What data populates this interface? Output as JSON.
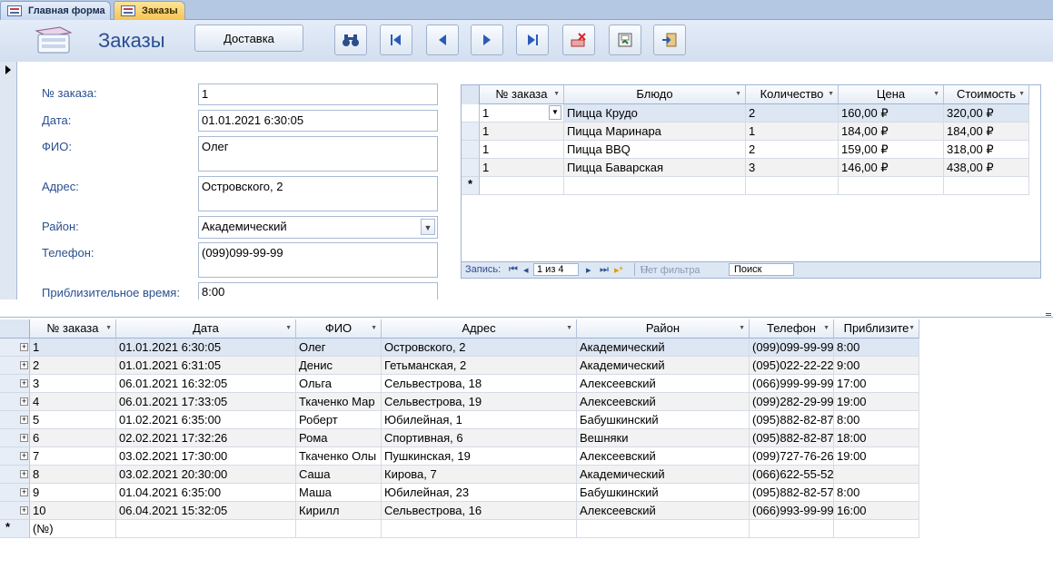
{
  "tabs": [
    {
      "label": "Главная форма",
      "active": false
    },
    {
      "label": "Заказы",
      "active": true
    }
  ],
  "header": {
    "title": "Заказы",
    "delivery_button": "Доставка",
    "nav_icons": [
      "binoculars-icon",
      "first-record-icon",
      "prev-record-icon",
      "next-record-icon",
      "last-record-icon",
      "delete-record-icon",
      "save-icon",
      "exit-icon"
    ]
  },
  "form": {
    "fields": [
      {
        "label": "№ заказа:",
        "value": "1"
      },
      {
        "label": "Дата:",
        "value": "01.01.2021 6:30:05"
      },
      {
        "label": "ФИО:",
        "value": "Олег"
      },
      {
        "label": "Адрес:",
        "value": "Островского, 2"
      },
      {
        "label": "Район:",
        "value": "Академический"
      },
      {
        "label": "Телефон:",
        "value": "(099)099-99-99"
      },
      {
        "label": "Приблизительное время:",
        "value": "8:00"
      }
    ]
  },
  "subform": {
    "columns": [
      "№ заказа",
      "Блюдо",
      "Количество",
      "Цена",
      "Стоимость"
    ],
    "rows": [
      [
        "1",
        "Пицца Крудо",
        "2",
        "160,00 ₽",
        "320,00 ₽"
      ],
      [
        "1",
        "Пицца Маринара",
        "1",
        "184,00 ₽",
        "184,00 ₽"
      ],
      [
        "1",
        "Пицца BBQ",
        "2",
        "159,00 ₽",
        "318,00 ₽"
      ],
      [
        "1",
        "Пицца Баварская",
        "3",
        "146,00 ₽",
        "438,00 ₽"
      ]
    ],
    "new_row_marker": "*",
    "nav": {
      "record_label": "Запись:",
      "position": "1 из 4",
      "filter": "Нет фильтра",
      "search": "Поиск"
    }
  },
  "main_grid": {
    "columns": [
      "№ заказа",
      "Дата",
      "ФИО",
      "Адрес",
      "Район",
      "Телефон",
      "Приблизите"
    ],
    "rows": [
      [
        "1",
        "01.01.2021 6:30:05",
        "Олег",
        "Островского, 2",
        "Академический",
        "(099)099-99-99",
        "8:00"
      ],
      [
        "2",
        "01.01.2021 6:31:05",
        "Денис",
        "Гетьманская, 2",
        "Академический",
        "(095)022-22-22",
        "9:00"
      ],
      [
        "3",
        "06.01.2021 16:32:05",
        "Ольга",
        "Сельвестрова, 18",
        "Алексеевский",
        "(066)999-99-99",
        "17:00"
      ],
      [
        "4",
        "06.01.2021 17:33:05",
        "Ткаченко Мар",
        "Сельвестрова, 19",
        "Алексеевский",
        "(099)282-29-99",
        "19:00"
      ],
      [
        "5",
        "01.02.2021 6:35:00",
        "Роберт",
        "Юбилейная, 1",
        "Бабушкинский",
        "(095)882-82-87",
        "8:00"
      ],
      [
        "6",
        "02.02.2021 17:32:26",
        "Рома",
        "Спортивная, 6",
        "Вешняки",
        "(095)882-82-87",
        "18:00"
      ],
      [
        "7",
        "03.02.2021 17:30:00",
        "Ткаченко Олы",
        "Пушкинская, 19",
        "Алексеевский",
        "(099)727-76-26",
        "19:00"
      ],
      [
        "8",
        "03.02.2021 20:30:00",
        "Саша",
        "Кирова, 7",
        "Академический",
        "(066)622-55-52",
        ""
      ],
      [
        "9",
        "01.04.2021 6:35:00",
        "Маша",
        "Юбилейная, 23",
        "Бабушкинский",
        "(095)882-82-57",
        "8:00"
      ],
      [
        "10",
        "06.04.2021 15:32:05",
        "Кирилл",
        "Сельвестрова, 16",
        "Алексеевский",
        "(066)993-99-99",
        "16:00"
      ]
    ],
    "new_row_marker": "*",
    "new_row_placeholder": "(№)"
  },
  "colors": {
    "accent": "#2a4f8f",
    "active_tab": "#f6c453",
    "header_bg": "#dfe7f2"
  }
}
